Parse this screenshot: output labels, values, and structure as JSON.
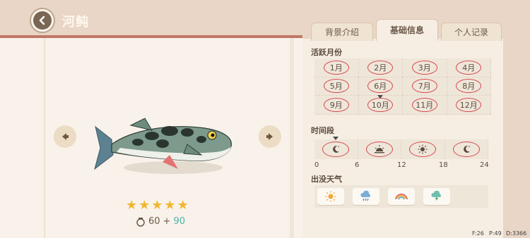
{
  "header": {
    "title": "河鲀"
  },
  "tabs": [
    {
      "label": "背景介绍",
      "active": false
    },
    {
      "label": "基础信息",
      "active": true
    },
    {
      "label": "个人记录",
      "active": false
    }
  ],
  "active_months": {
    "label": "活跃月份",
    "months": [
      "1月",
      "2月",
      "3月",
      "4月",
      "5月",
      "6月",
      "7月",
      "8月",
      "9月",
      "10月",
      "11月",
      "12月"
    ],
    "current_month": "10月"
  },
  "time_period": {
    "label": "时间段",
    "ticks": [
      "0",
      "6",
      "12",
      "18",
      "24"
    ],
    "slots": [
      "moon-icon",
      "sunrise-icon",
      "sun-icon",
      "moon-icon"
    ]
  },
  "weather": {
    "label": "出没天气",
    "icons": [
      "sun-icon",
      "rain-icon",
      "rainbow-icon",
      "thunderstorm-icon"
    ]
  },
  "fish": {
    "rarity_stars": 5,
    "price_base": "60",
    "price_plus": "+",
    "price_bonus": "90"
  },
  "footer": [
    "F:26",
    "P:49",
    "D:3366"
  ],
  "colors": {
    "accent_red": "#d7474a",
    "star": "#f2b62e",
    "bonus": "#4bb3a8"
  }
}
